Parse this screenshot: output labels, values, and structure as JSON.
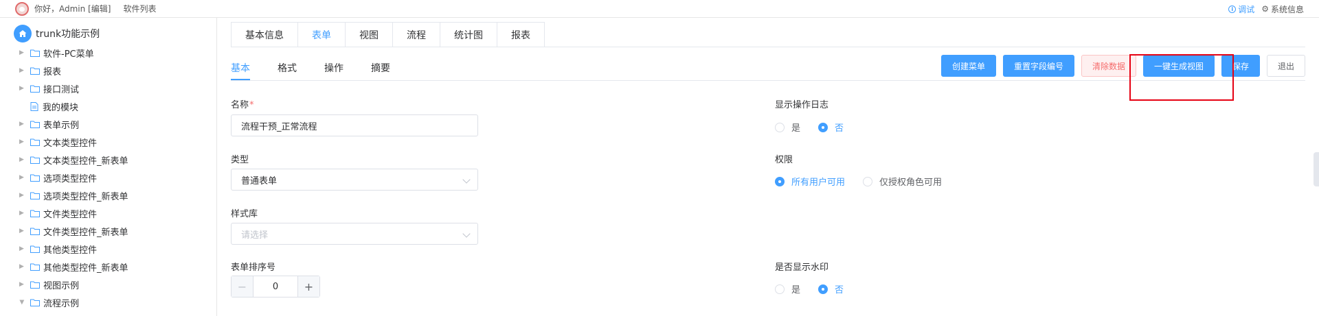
{
  "topbar": {
    "greeting": "你好，Admin [编辑]",
    "software_list": "软件列表",
    "debug": "调试",
    "system_info": "系统信息"
  },
  "sidebar": {
    "root": "trunk功能示例",
    "items": [
      {
        "label": "软件-PC菜单",
        "type": "folder"
      },
      {
        "label": "报表",
        "type": "folder"
      },
      {
        "label": "接口测试",
        "type": "folder"
      },
      {
        "label": "我的模块",
        "type": "doc"
      },
      {
        "label": "表单示例",
        "type": "folder"
      },
      {
        "label": "文本类型控件",
        "type": "folder"
      },
      {
        "label": "文本类型控件_新表单",
        "type": "folder"
      },
      {
        "label": "选项类型控件",
        "type": "folder"
      },
      {
        "label": "选项类型控件_新表单",
        "type": "folder"
      },
      {
        "label": "文件类型控件",
        "type": "folder"
      },
      {
        "label": "文件类型控件_新表单",
        "type": "folder"
      },
      {
        "label": "其他类型控件",
        "type": "folder"
      },
      {
        "label": "其他类型控件_新表单",
        "type": "folder"
      },
      {
        "label": "视图示例",
        "type": "folder"
      },
      {
        "label": "流程示例",
        "type": "folder-open"
      }
    ]
  },
  "tabs": {
    "top": [
      "基本信息",
      "表单",
      "视图",
      "流程",
      "统计图",
      "报表"
    ],
    "top_active": 1,
    "sub": [
      "基本",
      "格式",
      "操作",
      "摘要"
    ],
    "sub_active": 0
  },
  "toolbar": {
    "create_menu": "创建菜单",
    "reset_field_no": "重置字段编号",
    "clear_data": "清除数据",
    "generate_view": "一键生成视图",
    "save": "保存",
    "exit": "退出"
  },
  "form": {
    "name_label": "名称",
    "name_required": "*",
    "name_value": "流程干预_正常流程",
    "type_label": "类型",
    "type_value": "普通表单",
    "style_label": "样式库",
    "style_placeholder": "请选择",
    "order_label": "表单排序号",
    "order_value": "0",
    "log_label": "显示操作日志",
    "log_yes": "是",
    "log_no": "否",
    "perm_label": "权限",
    "perm_all": "所有用户可用",
    "perm_role": "仅授权角色可用",
    "watermark_label": "是否显示水印",
    "watermark_yes": "是",
    "watermark_no": "否"
  },
  "colors": {
    "primary": "#409eff",
    "danger": "#f56c6c",
    "highlight": "#e60012"
  }
}
